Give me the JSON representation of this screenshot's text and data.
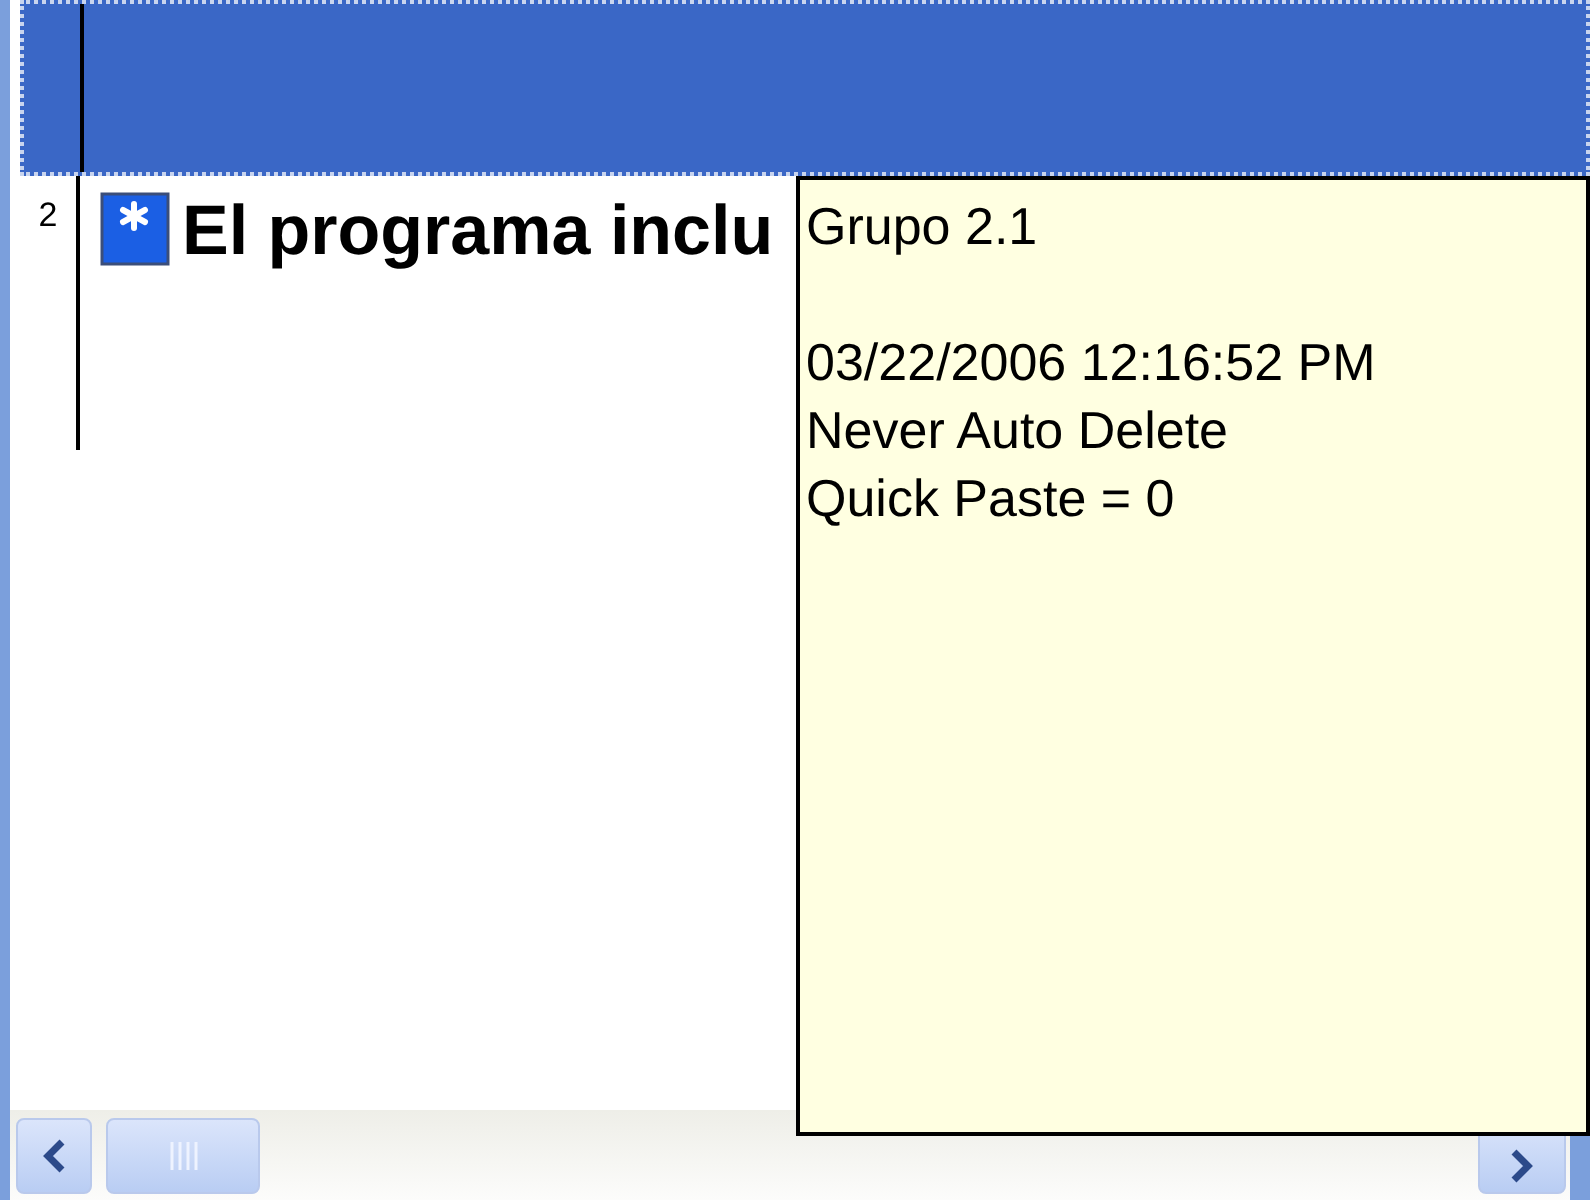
{
  "rows": [
    {
      "selected": true
    },
    {
      "number": "2",
      "text": "El programa inclu",
      "selected": false
    }
  ],
  "tooltip": {
    "title": "Grupo 2.1",
    "details": [
      "03/22/2006 12:16:52 PM",
      "Never Auto Delete",
      "Quick Paste = 0"
    ]
  }
}
